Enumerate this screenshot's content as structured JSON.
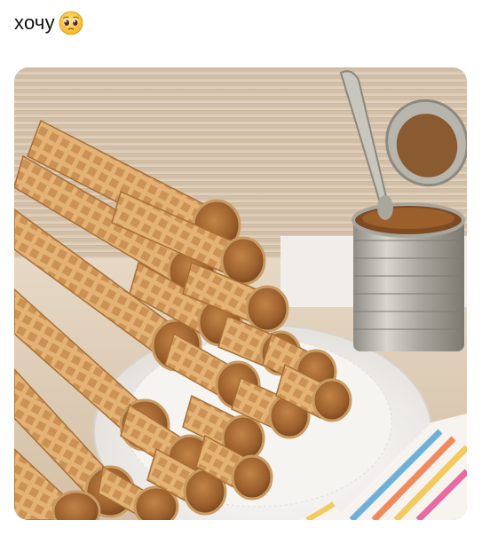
{
  "post": {
    "text": "хочу",
    "emoji": "pleading-face-emoji"
  },
  "photo": {
    "subject": "wafer-rolls-with-dulce-de-leche",
    "colors": {
      "background_wall": "#d8c4aa",
      "plate": "#f3f1ee",
      "wafer": "#d9a566",
      "caramel": "#a86a34",
      "can_metal": "#b9b6ad"
    }
  }
}
